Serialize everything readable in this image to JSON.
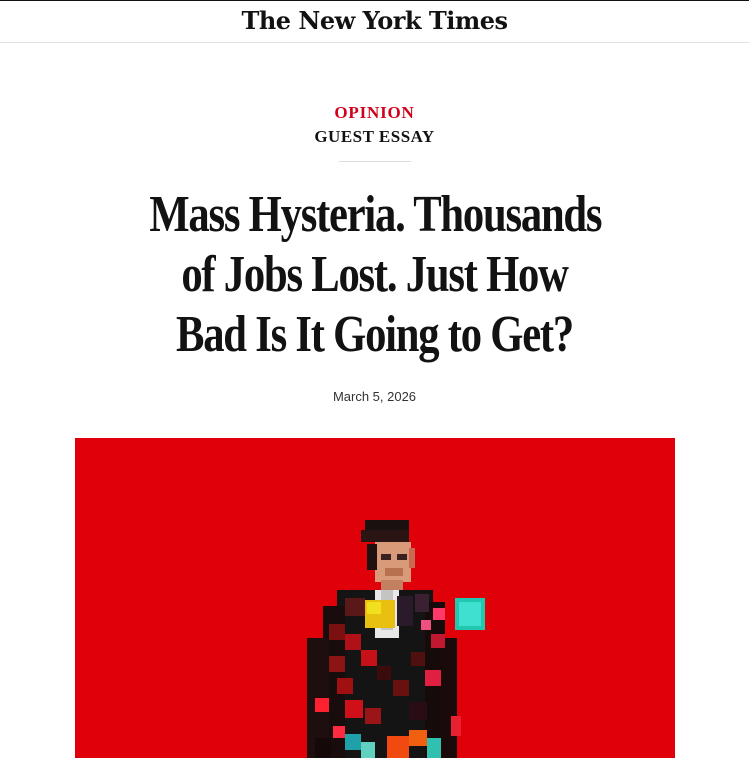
{
  "masthead": {
    "logo_text": "The New York Times"
  },
  "article": {
    "kicker": "OPINION",
    "label": "GUEST ESSAY",
    "headline_lines": [
      "Mass Hysteria. Thousands",
      "of Jobs Lost. Just How",
      "Bad Is It Going to Get?"
    ],
    "date": "March 5, 2026"
  },
  "hero_image": {
    "background_color": "#e0000a",
    "subject": "pixelated-man-figure"
  },
  "colors": {
    "kicker": "#d0021b",
    "text": "#121212"
  }
}
